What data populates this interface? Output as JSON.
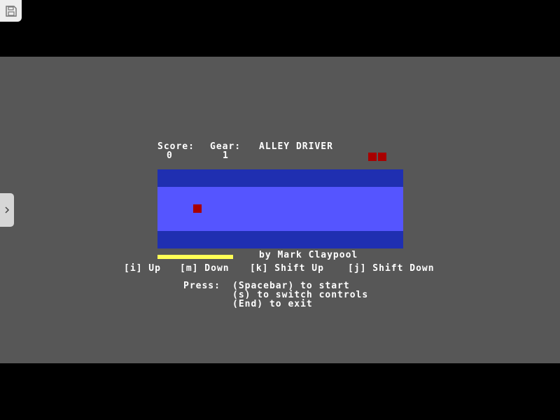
{
  "hud": {
    "score_label": "Score:",
    "gear_label": "Gear:",
    "title": "ALLEY DRIVER",
    "score_value": "0",
    "gear_value": "1",
    "lives": 2
  },
  "progress": {
    "fill_fraction": 0.31
  },
  "credit": "by Mark Claypool",
  "controls": {
    "up": "[i] Up",
    "down": "[m] Down",
    "shift_up": "[k] Shift Up",
    "shift_down": "[j] Shift Down"
  },
  "instructions": {
    "press_label": "Press:",
    "start": "(Spacebar) to start",
    "switch": "(s) to switch controls",
    "exit": "(End) to exit"
  },
  "colors": {
    "background": "#575757",
    "road_edge": "#1f2fb1",
    "road_lane": "#5555ff",
    "car": "#a80000",
    "bar": "#ffff55"
  },
  "icons": {
    "save": "floppy-disk-icon",
    "expand": "chevron-right-icon"
  }
}
